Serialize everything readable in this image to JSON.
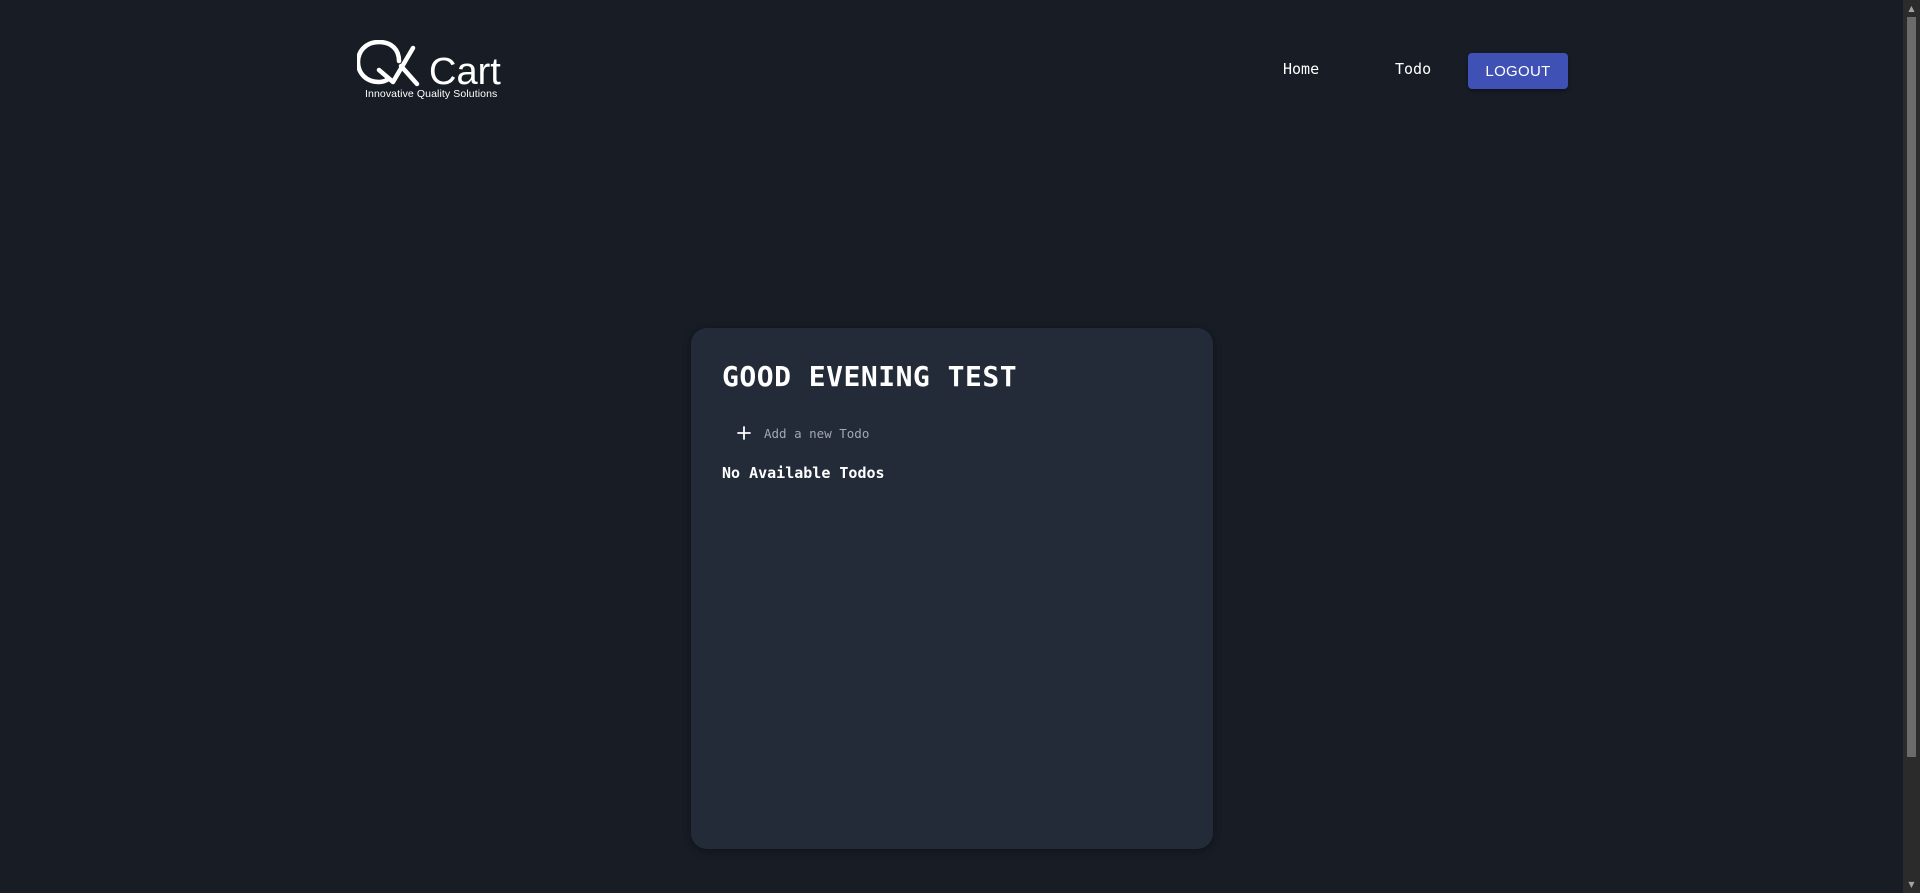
{
  "logo": {
    "tagline": "Innovative Quality Solutions",
    "brand_name": "QKart"
  },
  "nav": {
    "home_label": "Home",
    "todo_label": "Todo",
    "logout_label": "LOGOUT"
  },
  "card": {
    "greeting": "GOOD EVENING TEST",
    "add_todo": {
      "icon": "plus-icon",
      "placeholder": "Add a new Todo",
      "value": ""
    },
    "empty_message": "No Available Todos"
  },
  "colors": {
    "background": "#171c25",
    "card": "#222b37",
    "accent": "#3f51b5",
    "text": "#ffffff",
    "placeholder": "#a2a8b3"
  }
}
